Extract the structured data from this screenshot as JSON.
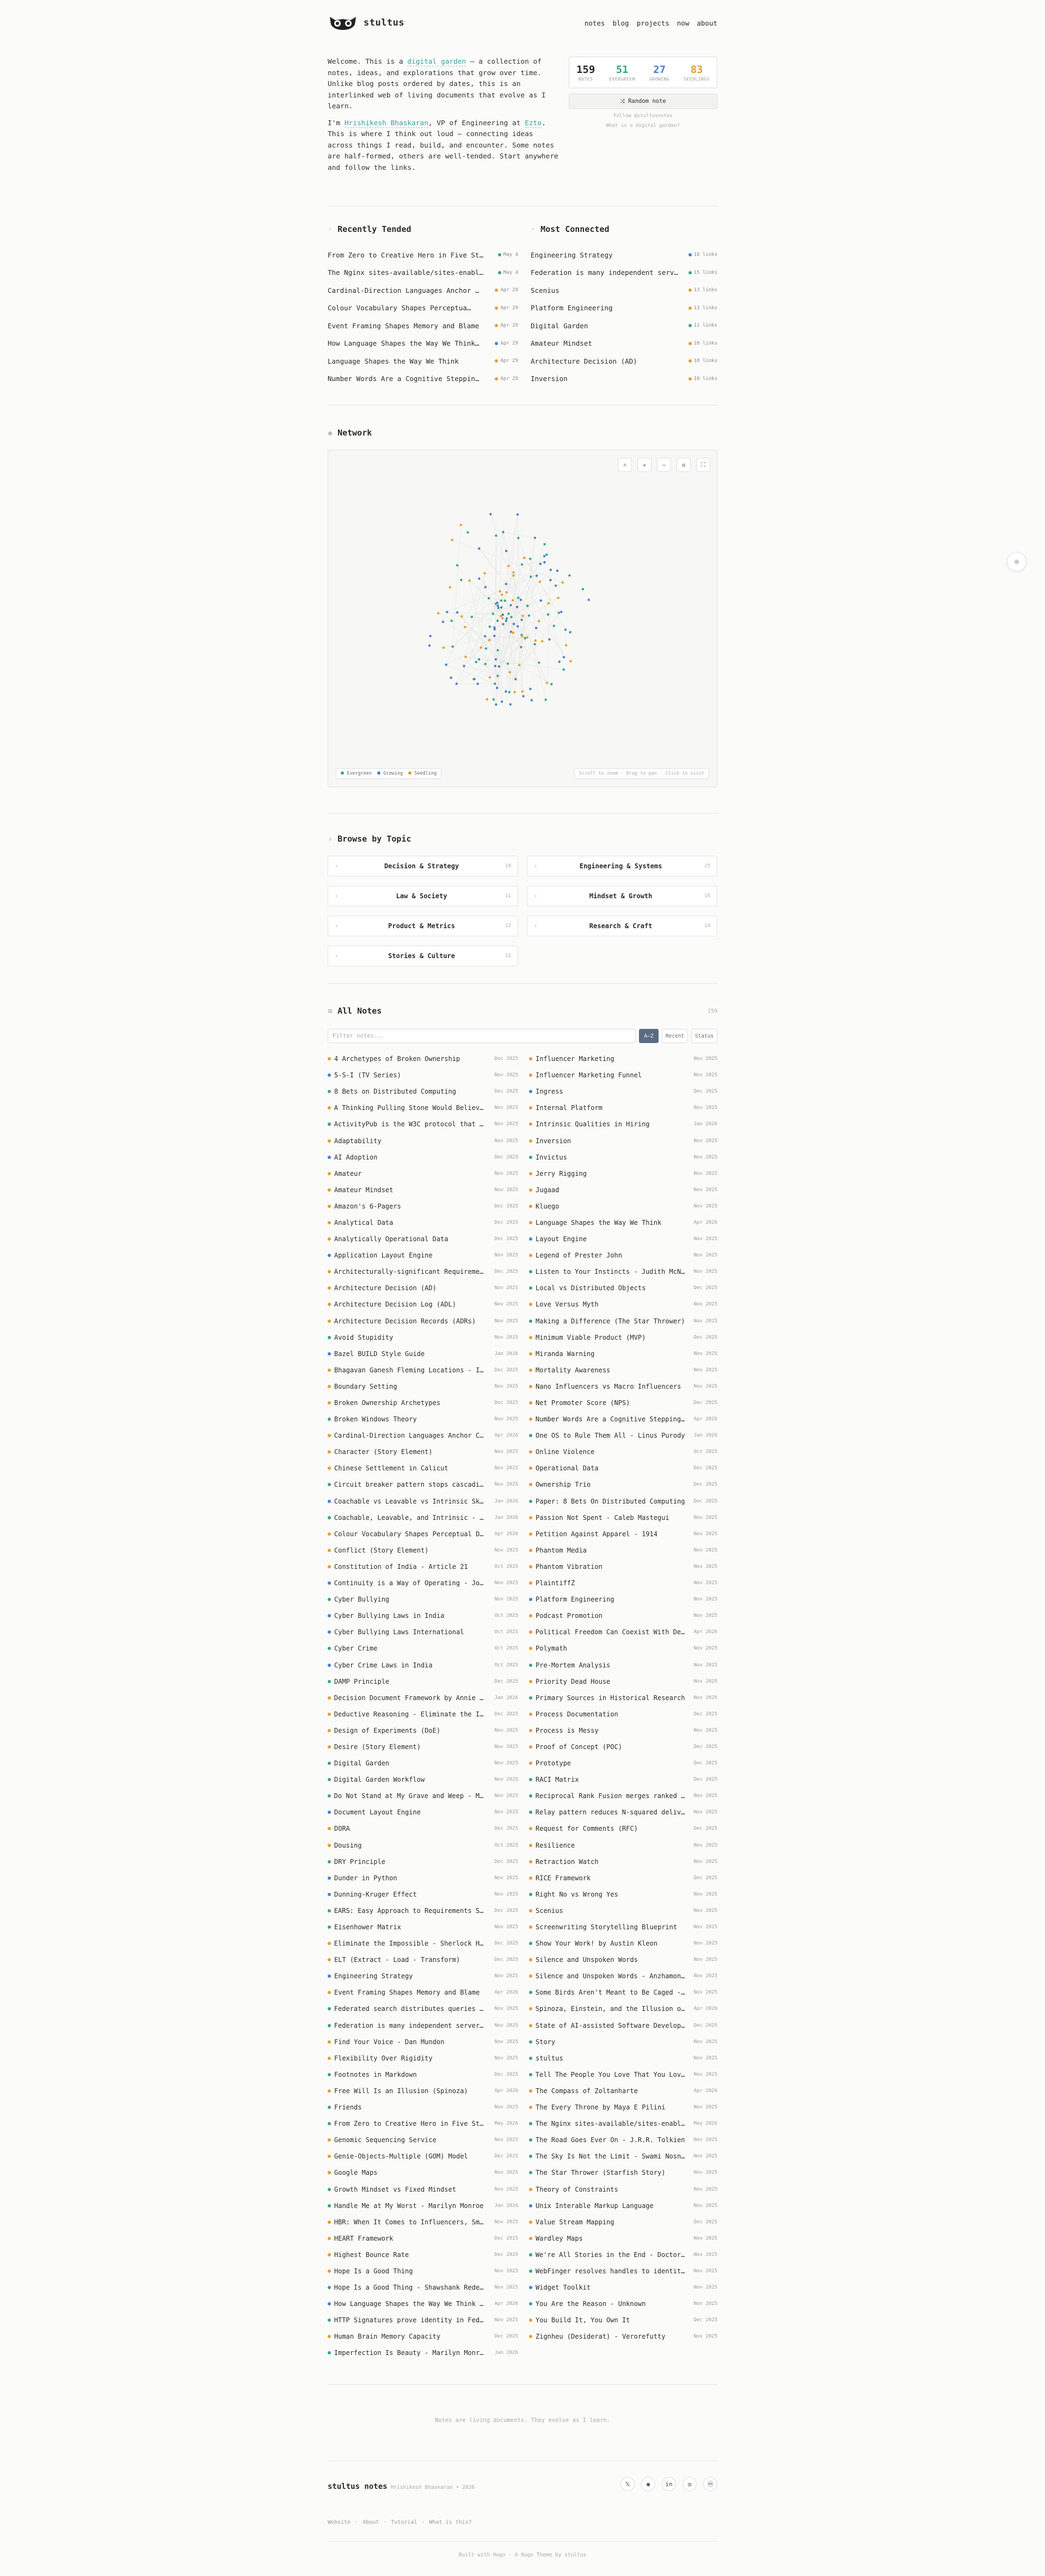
{
  "brand": {
    "name": "stultus"
  },
  "nav": [
    "notes",
    "blog",
    "projects",
    "now",
    "about"
  ],
  "intro": {
    "p1_pre": "Welcome. This is a ",
    "p1_link": "digital garden",
    "p1_post": " — a collection of notes, ideas, and explorations that grow over time. Unlike blog posts ordered by dates, this is an interlinked web of living documents that evolve as I learn.",
    "p2_pre": "I'm ",
    "p2_name": "Hrishikesh Bhaskaran",
    "p2_mid": ", VP of Engineering at ",
    "p2_company": "Ezto",
    "p2_post": ". This is where I think out loud — connecting ideas across things I read, build, and encounter. Some notes are half-formed, others are well-tended. Start anywhere and follow the links."
  },
  "stats": [
    {
      "n": "159",
      "l": "NOTES",
      "color": "#2b2b2b"
    },
    {
      "n": "51",
      "l": "EVERGREEN",
      "color": "#3aa38a"
    },
    {
      "n": "27",
      "l": "GROWING",
      "color": "#4a7fd0"
    },
    {
      "n": "83",
      "l": "SEEDLINGS",
      "color": "#e0a030"
    }
  ],
  "random_label": "⤨ Random note",
  "follow_label": "Follow @stultusnotes",
  "what_label": "What is a digital garden?",
  "recent": {
    "title": "Recently Tended",
    "items": [
      {
        "t": "From Zero to Creative Hero in Five St…",
        "d": "May 4",
        "c": "#3aa38a"
      },
      {
        "t": "The Nginx sites-available/sites-enabl…",
        "d": "May 4",
        "c": "#3aa38a"
      },
      {
        "t": "Cardinal-Direction Languages Anchor …",
        "d": "Apr 29",
        "c": "#e0a030"
      },
      {
        "t": "Colour Vocabulary Shapes Perceptua…",
        "d": "Apr 29",
        "c": "#e0a030"
      },
      {
        "t": "Event Framing Shapes Memory and Blame",
        "d": "Apr 29",
        "c": "#e0a030"
      },
      {
        "t": "How Language Shapes the Way We Think…",
        "d": "Apr 29",
        "c": "#4a7fd0"
      },
      {
        "t": "Language Shapes the Way We Think",
        "d": "Apr 29",
        "c": "#e0a030"
      },
      {
        "t": "Number Words Are a Cognitive Steppin…",
        "d": "Apr 29",
        "c": "#e0a030"
      }
    ]
  },
  "connected": {
    "title": "Most Connected",
    "items": [
      {
        "t": "Engineering Strategy",
        "d": "18 links",
        "c": "#4a7fd0"
      },
      {
        "t": "Federation is many independent serv…",
        "d": "15 links",
        "c": "#3aa38a"
      },
      {
        "t": "Scenius",
        "d": "13 links",
        "c": "#e0a030"
      },
      {
        "t": "Platform Engineering",
        "d": "13 links",
        "c": "#e0a030"
      },
      {
        "t": "Digital Garden",
        "d": "11 links",
        "c": "#3aa38a"
      },
      {
        "t": "Amateur Mindset",
        "d": "10 links",
        "c": "#e0a030"
      },
      {
        "t": "Architecture Decision (AD)",
        "d": "10 links",
        "c": "#e0a030"
      },
      {
        "t": "Inversion",
        "d": "10 links",
        "c": "#e0a030"
      }
    ]
  },
  "network": {
    "title": "Network",
    "legend": [
      {
        "l": "Evergreen",
        "c": "#3aa38a"
      },
      {
        "l": "Growing",
        "c": "#4a7fd0"
      },
      {
        "l": "Seedling",
        "c": "#e0a030"
      }
    ],
    "hint": "Scroll to zoom · Drag to pan · Click to visit"
  },
  "topics": {
    "title": "Browse by Topic",
    "items": [
      {
        "n": "Decision & Strategy",
        "c": "18"
      },
      {
        "n": "Engineering & Systems",
        "c": "25"
      },
      {
        "n": "Law & Society",
        "c": "11"
      },
      {
        "n": "Mindset & Growth",
        "c": "16"
      },
      {
        "n": "Product & Metrics",
        "c": "12"
      },
      {
        "n": "Research & Craft",
        "c": "14"
      },
      {
        "n": "Stories & Culture",
        "c": "12"
      }
    ]
  },
  "allnotes": {
    "title": "All Notes",
    "count": "159",
    "filter_placeholder": "Filter notes...",
    "sorts": [
      "A–Z",
      "Recent",
      "Status"
    ]
  },
  "notes_left": [
    [
      "4 Archetypes of Broken Ownership",
      "Dec 2025",
      "#e0a030"
    ],
    [
      "5-S-I (TV Series)",
      "Nov 2025",
      "#4a7fd0"
    ],
    [
      "8 Bets on Distributed Computing",
      "Dec 2025",
      "#3aa38a"
    ],
    [
      "A Thinking Pulling Stone Would Believe …",
      "Nov 2025",
      "#e0a030"
    ],
    [
      "ActivityPub is the W3C protocol that po…",
      "Nov 2025",
      "#3aa38a"
    ],
    [
      "Adaptability",
      "Nov 2025",
      "#e0a030"
    ],
    [
      "AI Adoption",
      "Dec 2025",
      "#4a7fd0"
    ],
    [
      "Amateur",
      "Nov 2025",
      "#e0a030"
    ],
    [
      "Amateur Mindset",
      "Nov 2025",
      "#e0a030"
    ],
    [
      "Amazon's 6-Pagers",
      "Dec 2025",
      "#e0a030"
    ],
    [
      "Analytical Data",
      "Dec 2025",
      "#e0a030"
    ],
    [
      "Analytically Operational Data",
      "Dec 2025",
      "#e0a030"
    ],
    [
      "Application Layout Engine",
      "Nov 2025",
      "#4a7fd0"
    ],
    [
      "Architecturally-significant Requirement…",
      "Dec 2025",
      "#e0a030"
    ],
    [
      "Architecture Decision (AD)",
      "Nov 2025",
      "#e0a030"
    ],
    [
      "Architecture Decision Log (ADL)",
      "Nov 2025",
      "#e0a030"
    ],
    [
      "Architecture Decision Records (ADRs)",
      "Nov 2025",
      "#e0a030"
    ],
    [
      "Avoid Stupidity",
      "Nov 2025",
      "#3aa38a"
    ],
    [
      "Bazel BUILD Style Guide",
      "Jan 2026",
      "#4a7fd0"
    ],
    [
      "Bhagavan Ganesh Fleming Locations - I…",
      "Dec 2025",
      "#e0a030"
    ],
    [
      "Boundary Setting",
      "Nov 2025",
      "#e0a030"
    ],
    [
      "Broken Ownership Archetypes",
      "Dec 2025",
      "#e0a030"
    ],
    [
      "Broken Windows Theory",
      "Nov 2025",
      "#3aa38a"
    ],
    [
      "Cardinal-Direction Languages Anchor Cog…",
      "Apr 2026",
      "#e0a030"
    ],
    [
      "Character (Story Element)",
      "Nov 2025",
      "#e0a030"
    ],
    [
      "Chinese Settlement in Calicut",
      "Nov 2025",
      "#e0a030"
    ],
    [
      "Circuit breaker pattern stops cascading…",
      "Nov 2025",
      "#3aa38a"
    ],
    [
      "Coachable vs Leavable vs Intrinsic Ski…",
      "Jan 2026",
      "#4a7fd0"
    ],
    [
      "Coachable, Leavable, and Intrinsic - A…",
      "Jan 2026",
      "#3aa38a"
    ],
    [
      "Colour Vocabulary Shapes Perceptual D…",
      "Apr 2026",
      "#e0a030"
    ],
    [
      "Conflict (Story Element)",
      "Nov 2025",
      "#e0a030"
    ],
    [
      "Constitution of India - Article 21",
      "Oct 2025",
      "#e0a030"
    ],
    [
      "Continuity is a Way of Operating - John…",
      "Nov 2025",
      "#4a7fd0"
    ],
    [
      "Cyber Bullying",
      "Nov 2025",
      "#3aa38a"
    ],
    [
      "Cyber Bullying Laws in India",
      "Oct 2025",
      "#4a7fd0"
    ],
    [
      "Cyber Bullying Laws International",
      "Oct 2025",
      "#4a7fd0"
    ],
    [
      "Cyber Crime",
      "Oct 2025",
      "#3aa38a"
    ],
    [
      "Cyber Crime Laws in India",
      "Oct 2025",
      "#4a7fd0"
    ],
    [
      "DAMP Principle",
      "Dec 2025",
      "#3aa38a"
    ],
    [
      "Decision Document Framework by Annie Du…",
      "Jan 2026",
      "#e0a030"
    ],
    [
      "Deductive Reasoning - Eliminate the Imp…",
      "Dec 2025",
      "#e0a030"
    ],
    [
      "Design of Experiments (DoE)",
      "Nov 2025",
      "#e0a030"
    ],
    [
      "Desire (Story Element)",
      "Nov 2025",
      "#e0a030"
    ],
    [
      "Digital Garden",
      "Nov 2025",
      "#3aa38a"
    ],
    [
      "Digital Garden Workflow",
      "Nov 2025",
      "#3aa38a"
    ],
    [
      "Do Not Stand at My Grave and Weep - Mary…",
      "Nov 2025",
      "#3aa38a"
    ],
    [
      "Document Layout Engine",
      "Nov 2025",
      "#4a7fd0"
    ],
    [
      "DORA",
      "Dec 2025",
      "#e0a030"
    ],
    [
      "Dousing",
      "Oct 2025",
      "#e0a030"
    ],
    [
      "DRY Principle",
      "Dec 2025",
      "#3aa38a"
    ],
    [
      "Dunder in Python",
      "Nov 2025",
      "#4a7fd0"
    ],
    [
      "Dunning-Kruger Effect",
      "Nov 2025",
      "#4a7fd0"
    ],
    [
      "EARS: Easy Approach to Requirements Syn…",
      "Dec 2025",
      "#3aa38a"
    ],
    [
      "Eisenhower Matrix",
      "Nov 2025",
      "#3aa38a"
    ],
    [
      "Eliminate the Impossible - Sherlock Hol…",
      "Dec 2025",
      "#e0a030"
    ],
    [
      "ELT (Extract - Load - Transform)",
      "Dec 2025",
      "#e0a030"
    ],
    [
      "Engineering Strategy",
      "Nov 2025",
      "#4a7fd0"
    ],
    [
      "Event Framing Shapes Memory and Blame",
      "Apr 2026",
      "#e0a030"
    ],
    [
      "Federated search distributes queries ac…",
      "Nov 2025",
      "#3aa38a"
    ],
    [
      "Federation is many independent servers …",
      "Nov 2025",
      "#3aa38a"
    ],
    [
      "Find Your Voice - Dan Mundon",
      "Nov 2025",
      "#e0a030"
    ],
    [
      "Flexibility Over Rigidity",
      "Nov 2025",
      "#e0a030"
    ],
    [
      "Footnotes in Markdown",
      "Dec 2025",
      "#3aa38a"
    ],
    [
      "Free Will Is an Illusion (Spinoza)",
      "Apr 2026",
      "#e0a030"
    ],
    [
      "Friends",
      "Nov 2025",
      "#3aa38a"
    ],
    [
      "From Zero to Creative Hero in Five Step…",
      "May 2026",
      "#3aa38a"
    ],
    [
      "Genomic Sequencing Service",
      "Nov 2025",
      "#e0a030"
    ],
    [
      "Genie-Objects-Multiple (GOM) Model",
      "Dec 2025",
      "#e0a030"
    ],
    [
      "Google Maps",
      "Nov 2025",
      "#e0a030"
    ],
    [
      "Growth Mindset vs Fixed Mindset",
      "Nov 2025",
      "#3aa38a"
    ],
    [
      "Handle Me at My Worst - Marilyn Monroe",
      "Jan 2026",
      "#3aa38a"
    ],
    [
      "HBR: When It Comes to Influencers, Smal…",
      "Nov 2025",
      "#e0a030"
    ],
    [
      "HEART Framework",
      "Dec 2025",
      "#e0a030"
    ],
    [
      "Highest Bounce Rate",
      "Dec 2025",
      "#e0a030"
    ],
    [
      "Hope Is a Good Thing",
      "Nov 2025",
      "#e0a030"
    ],
    [
      "Hope Is a Good Thing - Shawshank Redemp…",
      "Nov 2025",
      "#3aa38a"
    ],
    [
      "How Language Shapes the Way We Think -…",
      "Apr 2026",
      "#4a7fd0"
    ],
    [
      "HTTP Signatures prove identity in Feder…",
      "Nov 2025",
      "#3aa38a"
    ],
    [
      "Human Brain Memory Capacity",
      "Dec 2025",
      "#e0a030"
    ],
    [
      "Imperfection Is Beauty - Marilyn Monroe",
      "Jan 2026",
      "#3aa38a"
    ]
  ],
  "notes_right": [
    [
      "Influencer Marketing",
      "Nov 2025",
      "#e0a030"
    ],
    [
      "Influencer Marketing Funnel",
      "Nov 2025",
      "#e0a030"
    ],
    [
      "Ingress",
      "Dec 2025",
      "#4a7fd0"
    ],
    [
      "Internal Platform",
      "Nov 2025",
      "#e0a030"
    ],
    [
      "Intrinsic Qualities in Hiring",
      "Jan 2026",
      "#e0a030"
    ],
    [
      "Inversion",
      "Nov 2025",
      "#e0a030"
    ],
    [
      "Invictus",
      "Nov 2025",
      "#3aa38a"
    ],
    [
      "Jerry Rigging",
      "Nov 2025",
      "#e0a030"
    ],
    [
      "Jugaad",
      "Nov 2025",
      "#e0a030"
    ],
    [
      "Kluego",
      "Nov 2025",
      "#e0a030"
    ],
    [
      "Language Shapes the Way We Think",
      "Apr 2026",
      "#e0a030"
    ],
    [
      "Layout Engine",
      "Nov 2025",
      "#4a7fd0"
    ],
    [
      "Legend of Prester John",
      "Nov 2025",
      "#e0a030"
    ],
    [
      "Listen to Your Instincts - Judith McNau…",
      "Nov 2025",
      "#3aa38a"
    ],
    [
      "Local vs Distributed Objects",
      "Dec 2025",
      "#3aa38a"
    ],
    [
      "Love Versus Myth",
      "Nov 2025",
      "#e0a030"
    ],
    [
      "Making a Difference (The Star Thrower)",
      "Nov 2025",
      "#3aa38a"
    ],
    [
      "Minimum Viable Product (MVP)",
      "Dec 2025",
      "#e0a030"
    ],
    [
      "Miranda Warning",
      "Nov 2025",
      "#e0a030"
    ],
    [
      "Mortality Awareness",
      "Nov 2025",
      "#e0a030"
    ],
    [
      "Nano Influencers vs Macro Influencers",
      "Nov 2025",
      "#e0a030"
    ],
    [
      "Net Promoter Score (NPS)",
      "Dec 2025",
      "#e0a030"
    ],
    [
      "Number Words Are a Cognitive Stepping-S…",
      "Apr 2026",
      "#e0a030"
    ],
    [
      "One OS to Rule Them All - Linus Purody",
      "Jan 2026",
      "#3aa38a"
    ],
    [
      "Online Violence",
      "Oct 2025",
      "#e0a030"
    ],
    [
      "Operational Data",
      "Dec 2025",
      "#e0a030"
    ],
    [
      "Ownership Trio",
      "Dec 2025",
      "#e0a030"
    ],
    [
      "Paper: 8 Bets On Distributed Computing",
      "Dec 2025",
      "#3aa38a"
    ],
    [
      "Passion Not Spent - Caleb Mastegui",
      "Nov 2025",
      "#e0a030"
    ],
    [
      "Petition Against Apparel - 1914",
      "Nov 2025",
      "#e0a030"
    ],
    [
      "Phantom Media",
      "Nov 2025",
      "#e0a030"
    ],
    [
      "Phantom Vibration",
      "Nov 2025",
      "#e0a030"
    ],
    [
      "PlaintiffZ",
      "Nov 2025",
      "#e0a030"
    ],
    [
      "Platform Engineering",
      "Nov 2025",
      "#4a7fd0"
    ],
    [
      "Podcast Promotion",
      "Nov 2025",
      "#e0a030"
    ],
    [
      "Political Freedom Can Coexist With Dete…",
      "Apr 2026",
      "#e0a030"
    ],
    [
      "Polymath",
      "Nov 2025",
      "#e0a030"
    ],
    [
      "Pre-Mortem Analysis",
      "Nov 2025",
      "#3aa38a"
    ],
    [
      "Priority Dead House",
      "Nov 2025",
      "#e0a030"
    ],
    [
      "Primary Sources in Historical Research",
      "Nov 2025",
      "#3aa38a"
    ],
    [
      "Process Documentation",
      "Dec 2025",
      "#e0a030"
    ],
    [
      "Process is Messy",
      "Nov 2025",
      "#e0a030"
    ],
    [
      "Proof of Concept (POC)",
      "Dec 2025",
      "#e0a030"
    ],
    [
      "Prototype",
      "Dec 2025",
      "#e0a030"
    ],
    [
      "RACI Matrix",
      "Dec 2025",
      "#3aa38a"
    ],
    [
      "Reciprocal Rank Fusion merges ranked li…",
      "Nov 2025",
      "#3aa38a"
    ],
    [
      "Relay pattern reduces N-squared deliver…",
      "Nov 2025",
      "#3aa38a"
    ],
    [
      "Request for Comments (RFC)",
      "Dec 2025",
      "#e0a030"
    ],
    [
      "Resilience",
      "Nov 2025",
      "#e0a030"
    ],
    [
      "Retraction Watch",
      "Nov 2025",
      "#e0a030"
    ],
    [
      "RICE Framework",
      "Dec 2025",
      "#e0a030"
    ],
    [
      "Right No vs Wrong Yes",
      "Nov 2025",
      "#3aa38a"
    ],
    [
      "Scenius",
      "Nov 2025",
      "#e0a030"
    ],
    [
      "Screenwriting Storytelling Blueprint",
      "Nov 2025",
      "#e0a030"
    ],
    [
      "Show Your Work! by Austin Kleon",
      "Nov 2025",
      "#3aa38a"
    ],
    [
      "Silence and Unspoken Words",
      "Nov 2025",
      "#e0a030"
    ],
    [
      "Silence and Unspoken Words - Anzhamon S…",
      "Nov 2025",
      "#e0a030"
    ],
    [
      "Some Birds Aren't Meant to Be Caged - S…",
      "Nov 2025",
      "#3aa38a"
    ],
    [
      "Spinoza, Einstein, and the Illusion of …",
      "Apr 2026",
      "#e0a030"
    ],
    [
      "State of AI-assisted Software Developme…",
      "Dec 2025",
      "#e0a030"
    ],
    [
      "Story",
      "Nov 2025",
      "#3aa38a"
    ],
    [
      "stultus",
      "Nov 2025",
      "#3aa38a"
    ],
    [
      "Tell The People You Love That You Love …",
      "Nov 2025",
      "#3aa38a"
    ],
    [
      "The Compass of Zoltanharte",
      "Apr 2026",
      "#e0a030"
    ],
    [
      "The Every Throne by Maya E Pilini",
      "Nov 2025",
      "#e0a030"
    ],
    [
      "The Nginx sites-available/sites-enabled…",
      "May 2026",
      "#3aa38a"
    ],
    [
      "The Road Goes Ever On - J.R.R. Tolkien",
      "Nov 2025",
      "#3aa38a"
    ],
    [
      "The Sky Is Not the Limit - Swami Nosno…",
      "Nov 2025",
      "#3aa38a"
    ],
    [
      "The Star Thrower (Starfish Story)",
      "Nov 2025",
      "#3aa38a"
    ],
    [
      "Theory of Constraints",
      "Nov 2025",
      "#e0a030"
    ],
    [
      "Unix Interable Markup Language",
      "Nov 2025",
      "#4a7fd0"
    ],
    [
      "Value Stream Mapping",
      "Dec 2025",
      "#e0a030"
    ],
    [
      "Wardley Maps",
      "Nov 2025",
      "#e0a030"
    ],
    [
      "We're All Stories in the End - Doctor W…",
      "Nov 2025",
      "#3aa38a"
    ],
    [
      "WebFinger resolves handles to identity …",
      "Nov 2025",
      "#3aa38a"
    ],
    [
      "Widget Toolkit",
      "Nov 2025",
      "#4a7fd0"
    ],
    [
      "You Are the Reason - Unknown",
      "Nov 2025",
      "#3aa38a"
    ],
    [
      "You Build It, You Own It",
      "Dec 2025",
      "#e0a030"
    ],
    [
      "Zignheu (Desiderat) - Verorefutty",
      "Nov 2025",
      "#e0a030"
    ]
  ],
  "footer": {
    "note": "Notes are living documents. They evolve as I learn.",
    "brand": "stultus notes",
    "sub": "Hrishikesh Bhaskaran • 2026",
    "links": [
      "Website",
      "About",
      "Tutorial",
      "What is this?"
    ],
    "credit": "Built with Hugo · A Hugo Theme by stultus"
  }
}
